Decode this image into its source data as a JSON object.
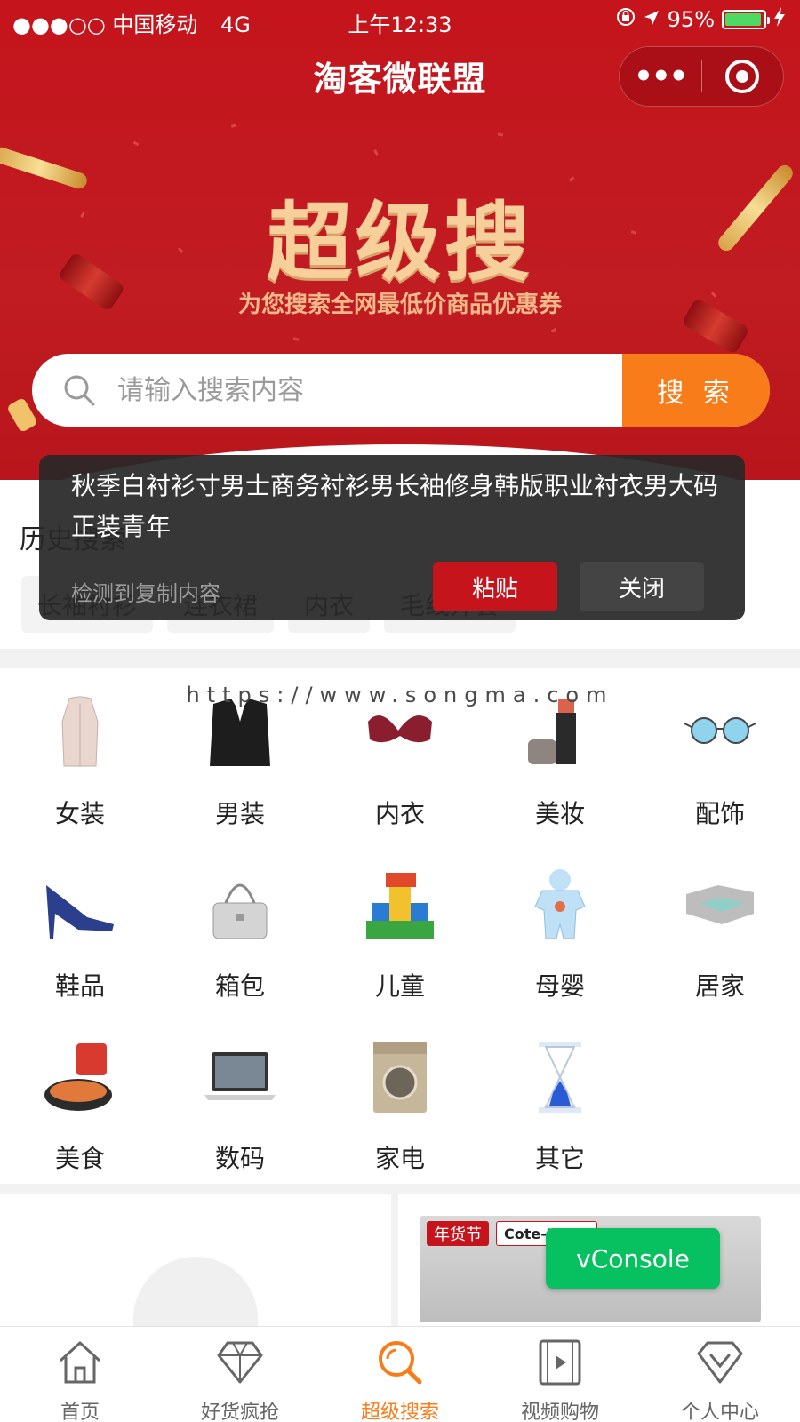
{
  "status_bar": {
    "carrier": "●●●○○ 中国移动",
    "network": "4G",
    "time": "上午12:33",
    "battery": "95%",
    "battery_level": 0.95
  },
  "nav": {
    "title": "淘客微联盟",
    "more_label": "•••"
  },
  "hero": {
    "title": "超级搜",
    "subtitle": "为您搜索全网最低价商品优惠券"
  },
  "search": {
    "placeholder": "请输入搜索内容",
    "button_label": "搜 索"
  },
  "history": {
    "title": "历史搜索",
    "chips": [
      "长袖衬衫",
      "连衣裙",
      "内衣",
      "毛线外套"
    ]
  },
  "clipboard_toast": {
    "content": "秋季白衬衫寸男士商务衬衫男长袖修身韩版职业衬衣男大码正装青年",
    "hint": "检测到复制内容",
    "paste_label": "粘贴",
    "close_label": "关闭"
  },
  "watermark": "https://www.songma.com",
  "categories": [
    {
      "label": "女装",
      "icon": "coat-icon"
    },
    {
      "label": "男装",
      "icon": "suit-icon"
    },
    {
      "label": "内衣",
      "icon": "bra-icon"
    },
    {
      "label": "美妆",
      "icon": "lipstick-icon"
    },
    {
      "label": "配饰",
      "icon": "sunglasses-icon"
    },
    {
      "label": "鞋品",
      "icon": "heels-icon"
    },
    {
      "label": "箱包",
      "icon": "handbag-icon"
    },
    {
      "label": "儿童",
      "icon": "toy-blocks-icon"
    },
    {
      "label": "母婴",
      "icon": "baby-romper-icon"
    },
    {
      "label": "居家",
      "icon": "sofa-icon"
    },
    {
      "label": "美食",
      "icon": "snack-icon"
    },
    {
      "label": "数码",
      "icon": "laptop-icon"
    },
    {
      "label": "家电",
      "icon": "washing-machine-icon"
    },
    {
      "label": "其它",
      "icon": "hourglass-icon"
    }
  ],
  "promo": {
    "tag_red": "年货节",
    "tag_white": "Cote-Make"
  },
  "vconsole_label": "vConsole",
  "tabbar": {
    "tabs": [
      {
        "label": "首页",
        "icon": "home-icon",
        "active": false
      },
      {
        "label": "好货疯抢",
        "icon": "diamond-icon",
        "active": false
      },
      {
        "label": "超级搜索",
        "icon": "search-icon",
        "active": true
      },
      {
        "label": "视频购物",
        "icon": "video-icon",
        "active": false
      },
      {
        "label": "个人中心",
        "icon": "profile-icon",
        "active": false
      }
    ]
  },
  "colors": {
    "brand_red": "#c5141c",
    "accent_orange": "#f97c1b",
    "vconsole_green": "#07c160"
  }
}
